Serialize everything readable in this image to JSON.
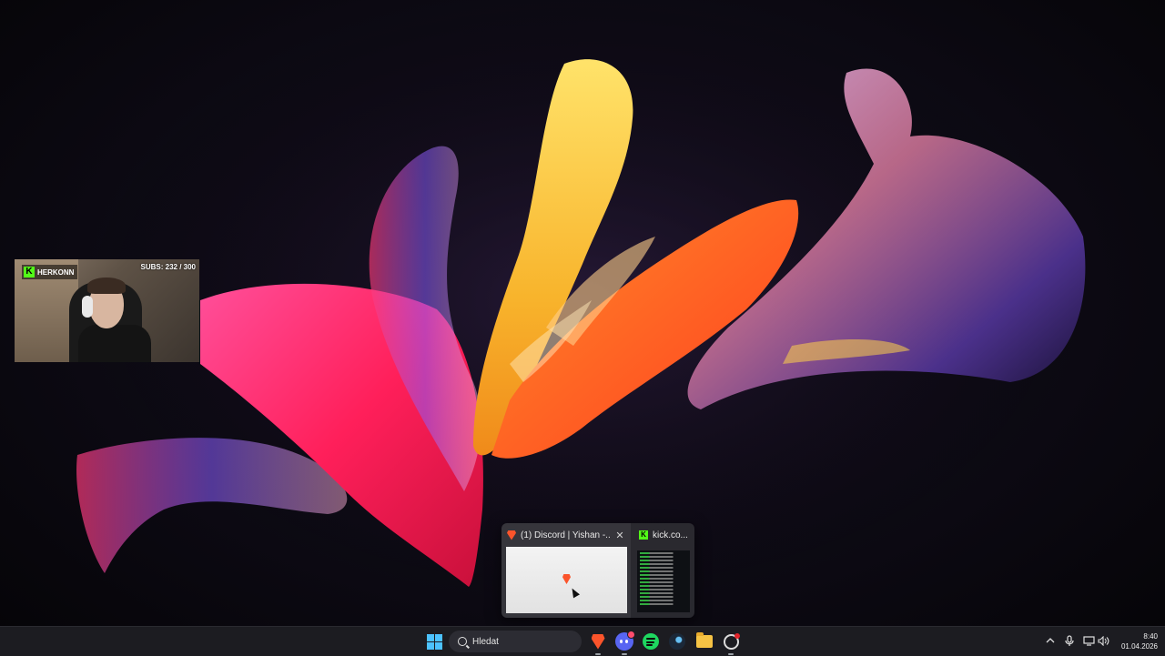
{
  "webcam": {
    "channel_name": "HERKONN",
    "subs_text": "SUBS: 232 / 300",
    "logo_icon": "kick-logo-icon"
  },
  "taskbar_preview": {
    "windows": [
      {
        "title": "(1) Discord | Yishan -...",
        "app_icon": "brave-icon",
        "close_glyph": "✕"
      },
      {
        "title": "kick.co...",
        "app_icon": "kick-icon"
      }
    ]
  },
  "taskbar": {
    "search_placeholder": "Hledat",
    "pinned_apps": [
      "windows-start-icon",
      "brave-icon",
      "discord-icon",
      "spotify-icon",
      "steam-icon",
      "file-explorer-icon",
      "obs-icon"
    ],
    "tray_icons": [
      "chevron-up-icon",
      "microphone-icon",
      "display-icon",
      "speaker-icon"
    ],
    "time": "8:40",
    "date": "01.04.2026"
  },
  "colors": {
    "taskbar_bg": "#1c1c21",
    "accent_blue": "#4cc2ff",
    "kick_green": "#53fc18",
    "brave_orange": "#fb542b",
    "discord_blurple": "#5865f2",
    "spotify_green": "#1ed760"
  }
}
